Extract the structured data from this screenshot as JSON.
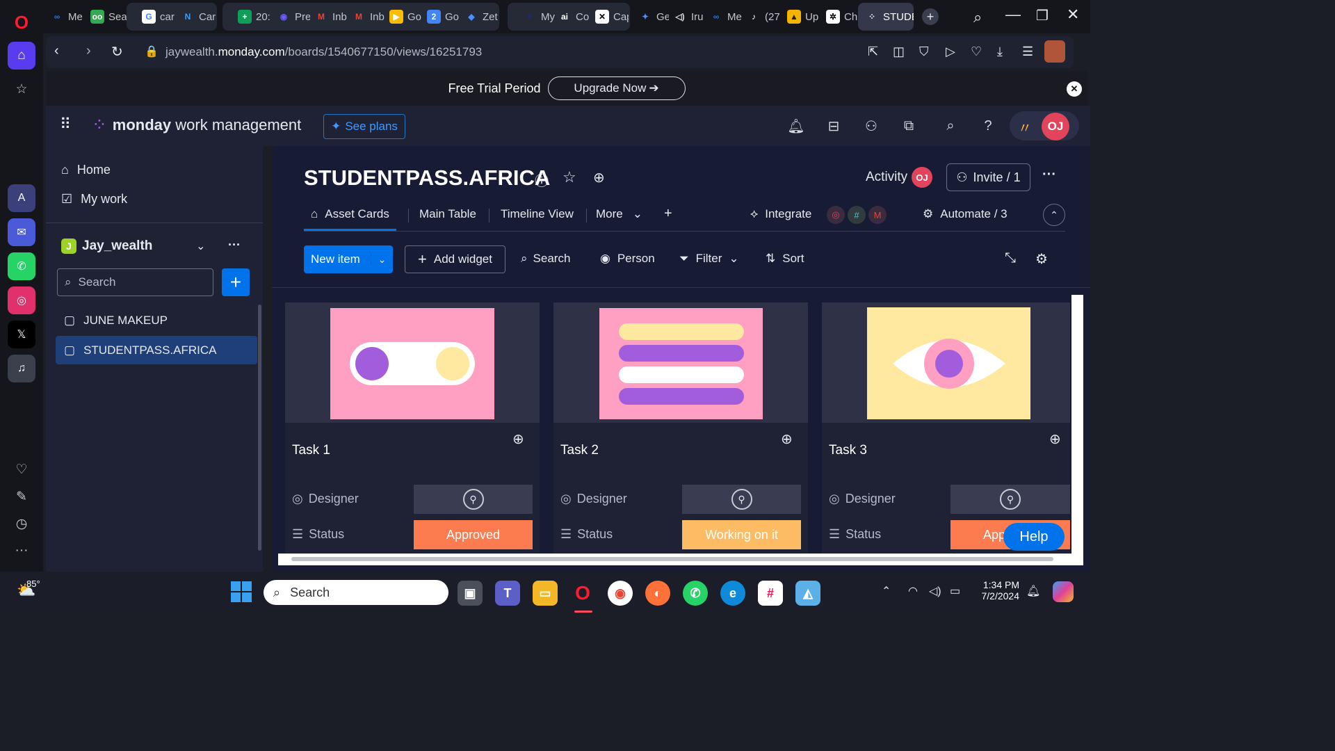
{
  "browser": {
    "tabs": [
      "Me",
      "Sea",
      "car",
      "Car",
      "20:",
      "Pre",
      "Inb",
      "Inb",
      "Go",
      "Go",
      "Zet",
      "My",
      "Co",
      "Cap",
      "Ge",
      "Iru",
      "Me",
      "(27",
      "Up",
      "Ch",
      "STUDE"
    ],
    "url_prefix": "jaywealth.",
    "url_domain": "monday.com",
    "url_path": "/boards/1540677150/views/16251793"
  },
  "banner": {
    "text": "Free Trial Period",
    "button": "Upgrade Now"
  },
  "header": {
    "brand_bold": "monday",
    "brand_rest": " work management",
    "see_plans": "See plans",
    "avatar": "OJ"
  },
  "leftnav": {
    "home": "Home",
    "mywork": "My work",
    "workspace_badge": "J",
    "workspace": "Jay_wealth",
    "search_placeholder": "Search",
    "boards": [
      "JUNE MAKEUP",
      "STUDENTPASS.AFRICA"
    ]
  },
  "board": {
    "title": "STUDENTPASS.AFRICA",
    "activity": "Activity",
    "activity_avatar": "OJ",
    "invite": "Invite / 1",
    "views": [
      "Asset Cards",
      "Main Table",
      "Timeline View",
      "More"
    ],
    "integrate": "Integrate",
    "automate": "Automate / 3"
  },
  "toolbar": {
    "new_item": "New item",
    "add_widget": "Add widget",
    "search": "Search",
    "person": "Person",
    "filter": "Filter",
    "sort": "Sort"
  },
  "cards": [
    {
      "title": "Task 1",
      "designer_label": "Designer",
      "status_label": "Status",
      "status": "Approved",
      "status_color": "#fd7c4f"
    },
    {
      "title": "Task 2",
      "designer_label": "Designer",
      "status_label": "Status",
      "status": "Working on it",
      "status_color": "#fdbc64"
    },
    {
      "title": "Task 3",
      "designer_label": "Designer",
      "status_label": "Status",
      "status": "App",
      "status_color": "#fd7c4f"
    }
  ],
  "help": "Help",
  "taskbar": {
    "weather": "85°",
    "search_placeholder": "Search",
    "time": "1:34 PM",
    "date": "7/2/2024"
  }
}
